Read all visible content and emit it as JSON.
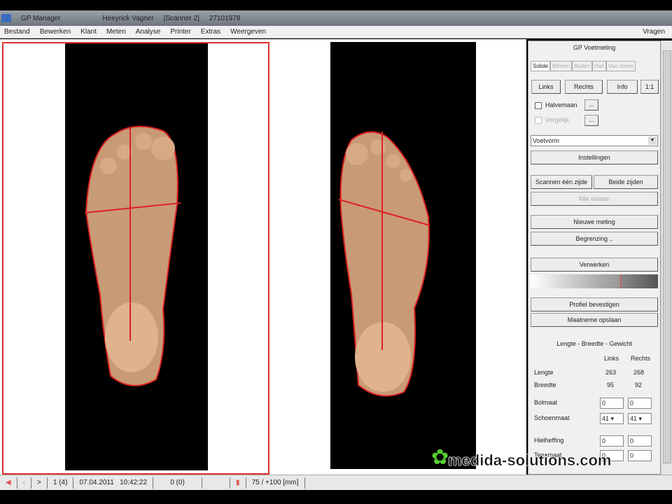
{
  "titlebar": {
    "app": "GP Manager",
    "client": "Heeyrick Vagner",
    "scanner": "[Scanner 2]",
    "date": "27101978"
  },
  "menu": [
    "Bestand",
    "Bewerken",
    "Klant",
    "Meten",
    "Analyse",
    "Printer",
    "Extras",
    "Weergeven"
  ],
  "menu_help": "Vragen",
  "panel": {
    "title": "GP Voetmeting",
    "tabs": [
      "Solide",
      "Binnen",
      "Buiten",
      "Hiel",
      "Van voren"
    ],
    "side_buttons": [
      "Links",
      "Rechts",
      "Info",
      "1:1"
    ],
    "checkboxes": [
      {
        "label": "Halvemaan",
        "checked": false
      },
      {
        "label": "Vergelijk",
        "checked": false
      }
    ],
    "ellipsis": "...",
    "dropdown_value": "Voetvorm",
    "settings": "Instellingen",
    "scan_one": "Scannen één zijde",
    "scan_both": "Beide zijden",
    "clear_all": "Alle wissen",
    "new_measure": "Nieuwe meting",
    "boundary": "Begrenzing ..",
    "process": "Verwerken",
    "confirm_profile": "Profiel bevestigen",
    "save_measure": "Maatneme opslaan",
    "section": "Lengte - Breedte - Gewicht",
    "col_left": "Links",
    "col_right": "Rechts",
    "rows": [
      {
        "label": "Lengte",
        "left": "263",
        "right": "268"
      },
      {
        "label": "Breedte",
        "left": "95",
        "right": "92"
      }
    ],
    "bolmaat": {
      "label": "Bolmaat",
      "left": "0",
      "right": "0"
    },
    "schoenmaat": {
      "label": "Schoenmaat",
      "left": "41",
      "right": "41"
    },
    "hielheffing": {
      "label": "Hielheffing",
      "left": "0",
      "right": "0"
    },
    "teenmaat": {
      "label": "Teenmaat",
      "left": "0",
      "right": "0"
    }
  },
  "status": {
    "record": "1 (4)",
    "date": "07.04.2011",
    "time": "10:42:22",
    "count": "0 (0)",
    "scale": "75 / +100 [mm]"
  },
  "watermark": "medida-solutions.com"
}
